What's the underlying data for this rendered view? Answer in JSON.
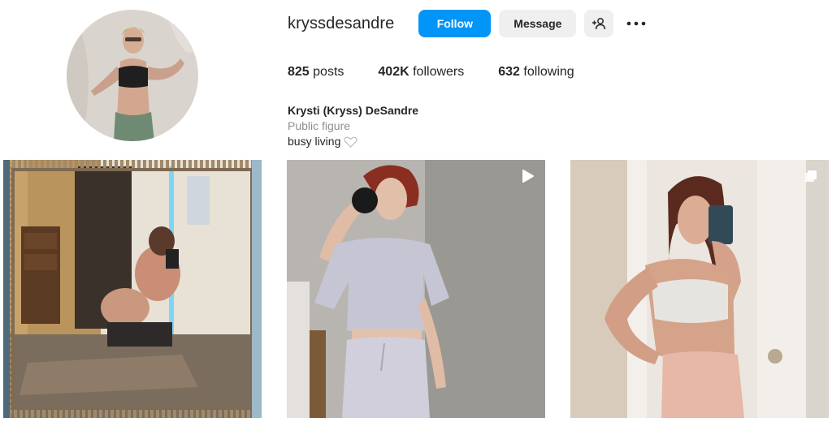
{
  "profile": {
    "username": "kryssdesandre",
    "avatar_icon": "profile-photo",
    "actions": {
      "follow_label": "Follow",
      "message_label": "Message",
      "suggest_icon": "add-person-icon",
      "more_icon": "more-horizontal-icon"
    },
    "stats": [
      {
        "value": "825",
        "label": "posts"
      },
      {
        "value": "402K",
        "label": "followers"
      },
      {
        "value": "632",
        "label": "following"
      }
    ],
    "bio": {
      "name": "Krysti (Kryss) DeSandre",
      "category": "Public figure",
      "text": "busy living",
      "text_icon": "heart-outline-icon"
    }
  },
  "posts": [
    {
      "type": "photo",
      "badge": ""
    },
    {
      "type": "reel",
      "badge": "play-icon"
    },
    {
      "type": "carousel",
      "badge": "multiple-posts-icon"
    }
  ],
  "colors": {
    "primary": "#0095f6",
    "secondary_button": "#efefef",
    "text": "#262626",
    "muted_text": "#8e8e8e"
  }
}
